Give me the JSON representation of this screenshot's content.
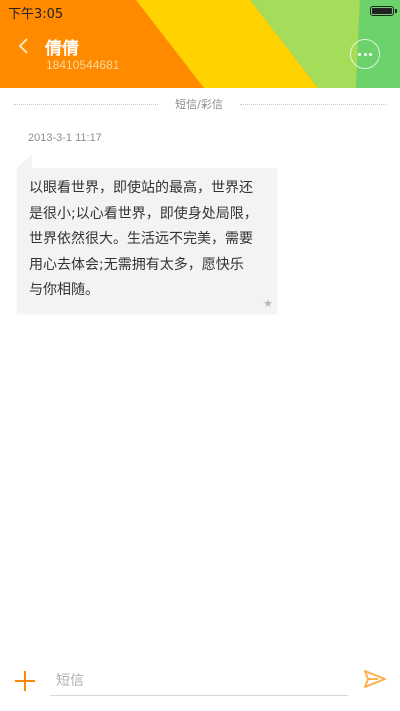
{
  "status_bar": {
    "time": "下午3:05"
  },
  "header": {
    "contact_name": "倩倩",
    "contact_number": "18410544681",
    "colors": {
      "orange": "#ff8a00",
      "yellow": "#ffd200",
      "light_green": "#a5dc5a",
      "green": "#6cd26c"
    }
  },
  "thread": {
    "channel_label": "短信/彩信",
    "messages": [
      {
        "timestamp": "2013-3-1 11:17",
        "lines": [
          "以眼看世界，即使站的最高，世界还",
          "是很小;以心看世界，即使身处局限，",
          "世界依然很大。生活远不完美，需要",
          "用心去体会;无需拥有太多，愿快乐",
          "与你相随。"
        ],
        "starred": true
      }
    ]
  },
  "composer": {
    "placeholder": "短信",
    "accent_color": "#ff8a00"
  }
}
